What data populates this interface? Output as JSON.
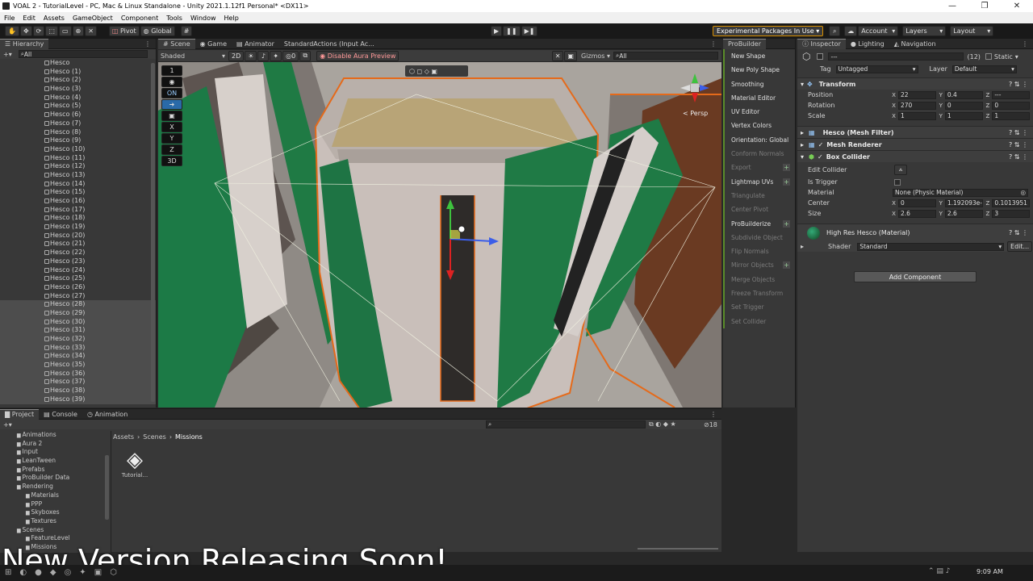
{
  "window": {
    "title": "VOAL 2 - TutorialLevel - PC, Mac & Linux Standalone - Unity 2021.1.12f1 Personal* <DX11>"
  },
  "menu": [
    "File",
    "Edit",
    "Assets",
    "GameObject",
    "Component",
    "Tools",
    "Window",
    "Help"
  ],
  "toolbar": {
    "pivot": "Pivot",
    "global": "Global",
    "experimental": "Experimental Packages In Use",
    "account": "Account",
    "layers": "Layers",
    "layout": "Layout"
  },
  "hierarchy": {
    "tab": "Hierarchy",
    "search": "All",
    "items": [
      "Hesco",
      "Hesco (1)",
      "Hesco (2)",
      "Hesco (3)",
      "Hesco (4)",
      "Hesco (5)",
      "Hesco (6)",
      "Hesco (7)",
      "Hesco (8)",
      "Hesco (9)",
      "Hesco (10)",
      "Hesco (11)",
      "Hesco (12)",
      "Hesco (13)",
      "Hesco (14)",
      "Hesco (15)",
      "Hesco (16)",
      "Hesco (17)",
      "Hesco (18)",
      "Hesco (19)",
      "Hesco (20)",
      "Hesco (21)",
      "Hesco (22)",
      "Hesco (23)",
      "Hesco (24)",
      "Hesco (25)",
      "Hesco (26)",
      "Hesco (27)",
      "Hesco (28)",
      "Hesco (29)",
      "Hesco (30)",
      "Hesco (31)",
      "Hesco (32)",
      "Hesco (33)",
      "Hesco (34)",
      "Hesco (35)",
      "Hesco (36)",
      "Hesco (37)",
      "Hesco (38)",
      "Hesco (39)"
    ]
  },
  "scene": {
    "tabs": [
      "Scene",
      "Game",
      "Animator",
      "StandardActions (Input Ac..."
    ],
    "shading": "Shaded",
    "mode2d": "2D",
    "gizmos": "Gizmos",
    "search": "All",
    "aura": "Disable Aura Preview",
    "persp": "< Persp",
    "overlay": [
      "1",
      "ON",
      "X",
      "Y",
      "Z",
      "3D"
    ],
    "zero": "0"
  },
  "probuilder": {
    "tab": "ProBuilder",
    "items": [
      {
        "label": "New Shape",
        "enabled": true
      },
      {
        "label": "New Poly Shape",
        "enabled": true
      },
      {
        "label": "Smoothing",
        "enabled": true
      },
      {
        "label": "Material Editor",
        "enabled": true
      },
      {
        "label": "UV Editor",
        "enabled": true
      },
      {
        "label": "Vertex Colors",
        "enabled": true
      },
      {
        "label": "Orientation: Global",
        "enabled": true
      },
      {
        "label": "Conform Normals",
        "enabled": false
      },
      {
        "label": "Export",
        "enabled": false,
        "plus": true
      },
      {
        "label": "Lightmap UVs",
        "enabled": true,
        "plus": true
      },
      {
        "label": "Triangulate",
        "enabled": false
      },
      {
        "label": "Center Pivot",
        "enabled": false
      },
      {
        "label": "ProBuilderize",
        "enabled": true,
        "plus": true
      },
      {
        "label": "Subdivide Object",
        "enabled": false
      },
      {
        "label": "Flip Normals",
        "enabled": false
      },
      {
        "label": "Mirror Objects",
        "enabled": false,
        "plus": true
      },
      {
        "label": "Merge Objects",
        "enabled": false
      },
      {
        "label": "Freeze Transform",
        "enabled": false
      },
      {
        "label": "Set Trigger",
        "enabled": false
      },
      {
        "label": "Set Collider",
        "enabled": false
      }
    ]
  },
  "inspector": {
    "tabs": [
      "Inspector",
      "Lighting",
      "Navigation"
    ],
    "name": "---",
    "count": "(12)",
    "static": "Static",
    "tag_label": "Tag",
    "tag": "Untagged",
    "layer_label": "Layer",
    "layer": "Default",
    "transform": {
      "title": "Transform",
      "position_label": "Position",
      "rotation_label": "Rotation",
      "scale_label": "Scale",
      "position": [
        "22",
        "0.4",
        "---"
      ],
      "rotation": [
        "270",
        "0",
        "0"
      ],
      "scale": [
        "1",
        "1",
        "1"
      ]
    },
    "mesh_filter": "Hesco (Mesh Filter)",
    "mesh_renderer": "Mesh Renderer",
    "box_collider": {
      "title": "Box Collider",
      "edit": "Edit Collider",
      "trigger": "Is Trigger",
      "material_label": "Material",
      "material": "None (Physic Material)",
      "center_label": "Center",
      "center": [
        "0",
        "1.192093e-",
        "0.1013951"
      ],
      "size_label": "Size",
      "size": [
        "2.6",
        "2.6",
        "3"
      ]
    },
    "material": {
      "title": "High Res Hesco (Material)",
      "shader_label": "Shader",
      "shader": "Standard",
      "edit": "Edit..."
    },
    "add_component": "Add Component",
    "axes": [
      "X",
      "Y",
      "Z"
    ]
  },
  "project": {
    "tabs": [
      "Project",
      "Console",
      "Animation"
    ],
    "breadcrumb": [
      "Assets",
      "Scenes",
      "Missions"
    ],
    "tree": [
      {
        "label": "Animations",
        "indent": 1
      },
      {
        "label": "Aura 2",
        "indent": 1
      },
      {
        "label": "Input",
        "indent": 1
      },
      {
        "label": "LeanTween",
        "indent": 1
      },
      {
        "label": "Prefabs",
        "indent": 1
      },
      {
        "label": "ProBuilder Data",
        "indent": 1
      },
      {
        "label": "Rendering",
        "indent": 1
      },
      {
        "label": "Materials",
        "indent": 2
      },
      {
        "label": "PPP",
        "indent": 2
      },
      {
        "label": "Skyboxes",
        "indent": 2
      },
      {
        "label": "Textures",
        "indent": 2
      },
      {
        "label": "Scenes",
        "indent": 1
      },
      {
        "label": "FeatureLevel",
        "indent": 2
      },
      {
        "label": "Missions",
        "indent": 2
      }
    ],
    "asset": "Tutorial...",
    "count": "18"
  },
  "banner": "New Version Releasing Soon!",
  "taskbar": {
    "time": "9:09 AM"
  }
}
